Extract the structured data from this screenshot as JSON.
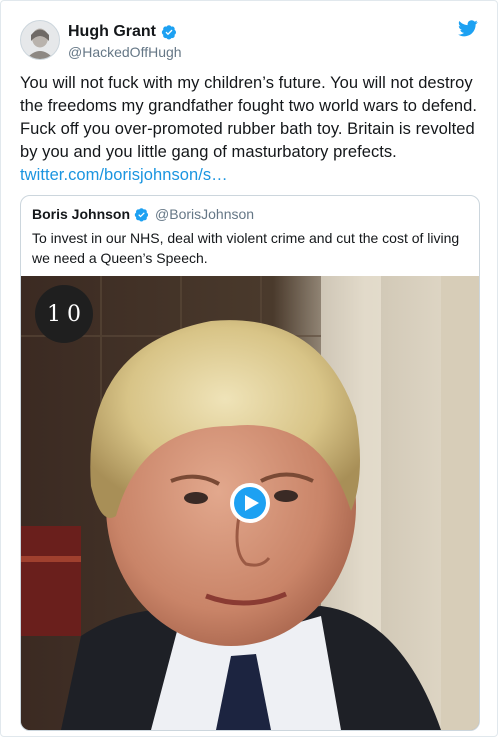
{
  "tweet": {
    "author": {
      "display_name": "Hugh Grant",
      "handle": "@HackedOffHugh",
      "verified": true,
      "avatar_icon": "avatar-photo"
    },
    "text_lines": [
      "You will not fuck with my children’s future. You will not destroy",
      "the freedoms my grandfather fought two world wars to defend.",
      "Fuck off you over-promoted rubber bath toy. Britain is revolted",
      "by you and you little gang of masturbatory prefects."
    ],
    "link": "twitter.com/borisjohnson/s…",
    "brand_icon": "twitter-bird-icon",
    "brand_color": "#1da1f2"
  },
  "quoted_tweet": {
    "author": {
      "display_name": "Boris Johnson",
      "handle": "@BorisJohnson",
      "verified": true
    },
    "text_lines": [
      "To invest in our NHS, deal with violent crime and cut the cost of living",
      "we need a Queen’s Speech."
    ],
    "video": {
      "badge_text": "10",
      "play_icon": "play-icon"
    }
  },
  "colors": {
    "text": "#14171a",
    "secondary": "#657786",
    "link": "#1b95e0",
    "border": "#ccd6dd"
  }
}
